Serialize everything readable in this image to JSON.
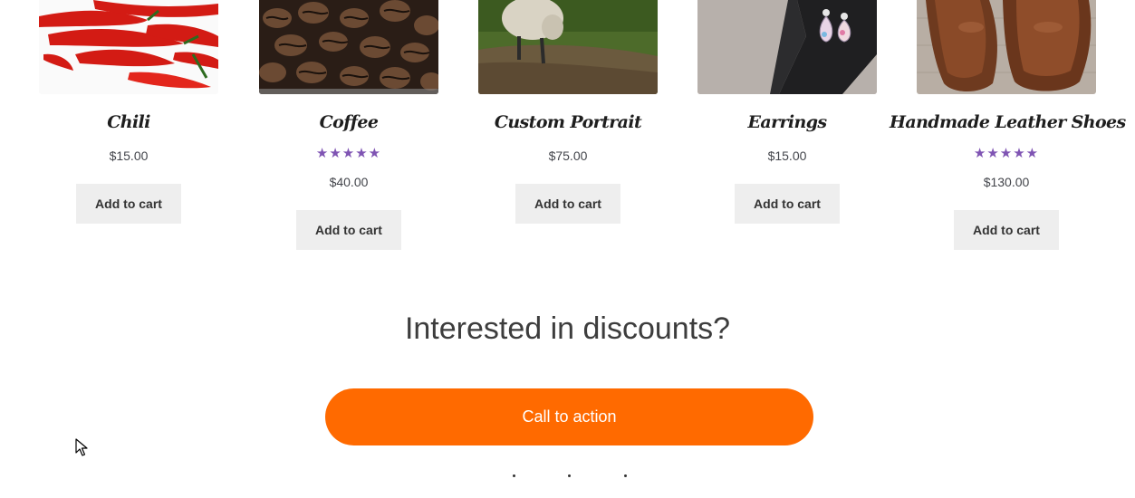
{
  "products": [
    {
      "name": "Chili",
      "image": "red chili peppers",
      "price": "$15.00",
      "rating": null,
      "button": "Add to cart"
    },
    {
      "name": "Coffee",
      "image": "coffee beans",
      "price": "$40.00",
      "rating": 5,
      "button": "Add to cart"
    },
    {
      "name": "Custom Portrait",
      "image": "sheep on grass",
      "price": "$75.00",
      "rating": null,
      "button": "Add to cart"
    },
    {
      "name": "Earrings",
      "image": "earrings on leather",
      "price": "$15.00",
      "rating": null,
      "button": "Add to cart"
    },
    {
      "name": "Handmade Leather Shoes",
      "image": "brown leather shoes",
      "price": "$130.00",
      "rating": 5,
      "button": "Add to cart"
    }
  ],
  "stars": "★★★★★",
  "promo": {
    "heading": "Interested in discounts?",
    "cta_label": "Call to action"
  },
  "colors": {
    "accent": "#ff6a00",
    "star": "#7f54b3",
    "button_bg": "#eeeeee"
  },
  "icons": {
    "cursor": "mouse-pointer-icon"
  }
}
